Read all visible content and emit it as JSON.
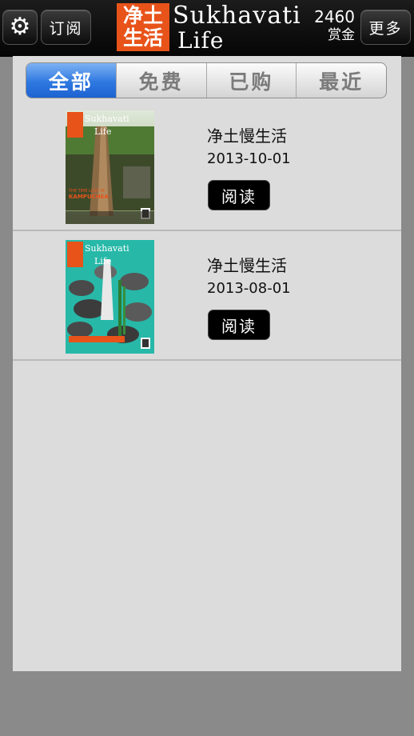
{
  "header": {
    "settings_icon": "gear-icon",
    "subscribe_label": "订阅",
    "logo_chinese_line1": "净土",
    "logo_chinese_line2": "生活",
    "logo_title_line1": "Sukhavati",
    "logo_title_line2": "Life",
    "bounty_value": "2460",
    "bounty_label": "赏金",
    "more_label": "更多"
  },
  "tabs": [
    {
      "label": "全部",
      "active": true
    },
    {
      "label": "免费",
      "active": false
    },
    {
      "label": "已购",
      "active": false
    },
    {
      "label": "最近",
      "active": false
    }
  ],
  "issues": [
    {
      "title": "净土慢生活",
      "date": "2013-10-01",
      "read_label": "阅读"
    },
    {
      "title": "净土慢生活",
      "date": "2013-08-01",
      "read_label": "阅读"
    }
  ],
  "colors": {
    "brand_orange": "#e8531a",
    "tab_active_blue": "#2e78e0",
    "panel_bg": "#dcdcdc"
  }
}
